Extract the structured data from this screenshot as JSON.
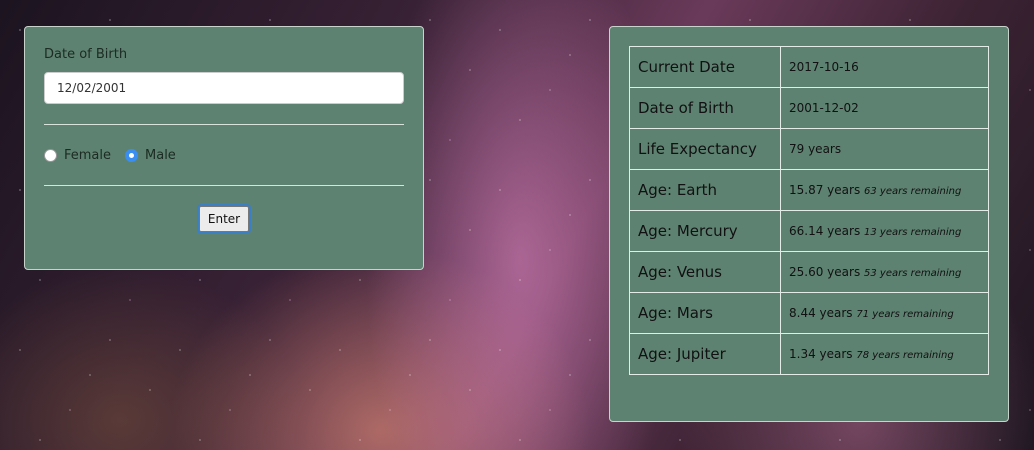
{
  "form": {
    "dob_label": "Date of Birth",
    "dob_value": "12/02/2001",
    "gender_options": [
      {
        "label": "Female",
        "selected": false
      },
      {
        "label": "Male",
        "selected": true
      }
    ],
    "enter_label": "Enter"
  },
  "results": {
    "rows": [
      {
        "key": "Current Date",
        "value": "2017-10-16",
        "remaining": ""
      },
      {
        "key": "Date of Birth",
        "value": "2001-12-02",
        "remaining": ""
      },
      {
        "key": "Life Expectancy",
        "value": "79 years",
        "remaining": ""
      },
      {
        "key": "Age: Earth",
        "value": "15.87 years",
        "remaining": "63 years remaining"
      },
      {
        "key": "Age: Mercury",
        "value": "66.14 years",
        "remaining": "13 years remaining"
      },
      {
        "key": "Age: Venus",
        "value": "25.60 years",
        "remaining": "53 years remaining"
      },
      {
        "key": "Age: Mars",
        "value": "8.44 years",
        "remaining": "71 years remaining"
      },
      {
        "key": "Age: Jupiter",
        "value": "1.34 years",
        "remaining": "78 years remaining"
      }
    ]
  },
  "colors": {
    "panel": "#5e8271",
    "radio_accent": "#3b8ef0"
  }
}
